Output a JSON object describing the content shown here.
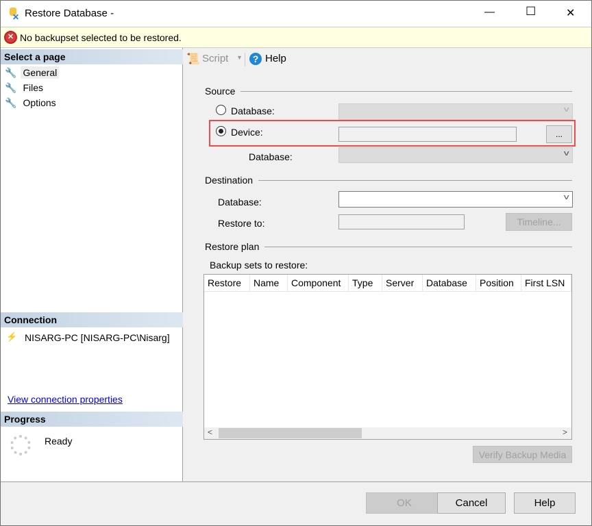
{
  "window": {
    "title": "Restore Database -",
    "minimize": "—",
    "maximize": "☐",
    "close": "✕"
  },
  "banner": {
    "message": "No backupset selected to be restored."
  },
  "sidebar": {
    "select_page_header": "Select a page",
    "pages": [
      {
        "label": "General"
      },
      {
        "label": "Files"
      },
      {
        "label": "Options"
      }
    ],
    "connection_header": "Connection",
    "connection_text": "NISARG-PC [NISARG-PC\\Nisarg]",
    "view_connection_link": "View connection properties",
    "progress_header": "Progress",
    "progress_status": "Ready"
  },
  "toolbar": {
    "script_label": "Script",
    "help_label": "Help"
  },
  "source": {
    "title": "Source",
    "database_radio": "Database:",
    "device_radio": "Device:",
    "browse_label": "...",
    "database_label": "Database:",
    "selected": "device"
  },
  "destination": {
    "title": "Destination",
    "database_label": "Database:",
    "restore_to_label": "Restore to:",
    "timeline_label": "Timeline..."
  },
  "restore_plan": {
    "title": "Restore plan",
    "backup_sets_label": "Backup sets to restore:",
    "columns": [
      "Restore",
      "Name",
      "Component",
      "Type",
      "Server",
      "Database",
      "Position",
      "First LSN"
    ],
    "verify_label": "Verify Backup Media"
  },
  "footer": {
    "ok": "OK",
    "cancel": "Cancel",
    "help": "Help"
  },
  "colors": {
    "highlight": "#f04a4a",
    "banner": "#ffffe1"
  }
}
